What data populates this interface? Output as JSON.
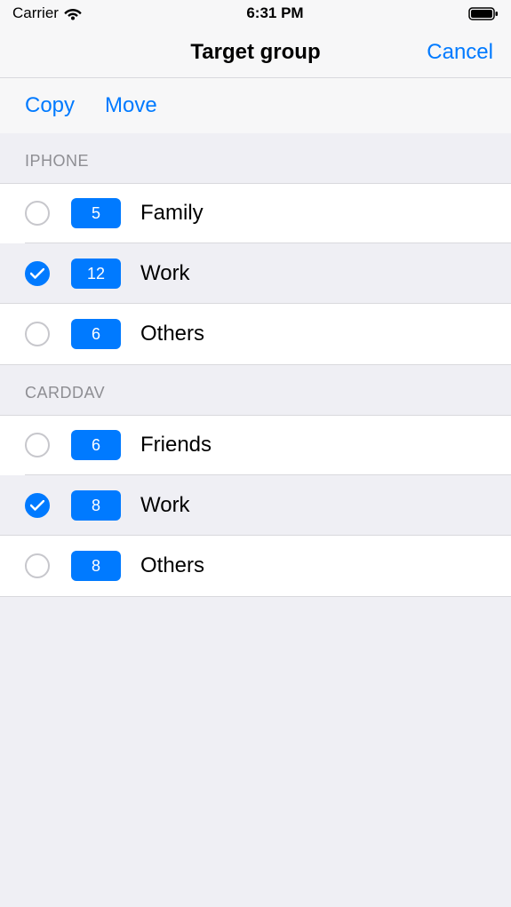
{
  "status": {
    "carrier": "Carrier",
    "time": "6:31 PM"
  },
  "nav": {
    "title": "Target group",
    "cancel": "Cancel"
  },
  "toolbar": {
    "copy": "Copy",
    "move": "Move"
  },
  "sections": [
    {
      "header": "IPHONE",
      "rows": [
        {
          "label": "Family",
          "count": "5",
          "selected": false
        },
        {
          "label": "Work",
          "count": "12",
          "selected": true
        },
        {
          "label": "Others",
          "count": "6",
          "selected": false
        }
      ]
    },
    {
      "header": "CARDDAV",
      "rows": [
        {
          "label": "Friends",
          "count": "6",
          "selected": false
        },
        {
          "label": "Work",
          "count": "8",
          "selected": true
        },
        {
          "label": "Others",
          "count": "8",
          "selected": false
        }
      ]
    }
  ]
}
